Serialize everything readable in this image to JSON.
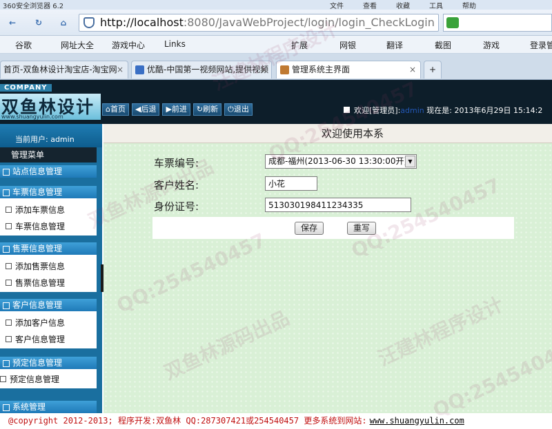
{
  "browser": {
    "app_name": "360安全浏览器 6.2",
    "menus": [
      "文件",
      "查看",
      "收藏",
      "工具",
      "帮助"
    ],
    "url_host": "http://localhost",
    "url_rest": ":8080/JavaWebProject/login/login_CheckLogin",
    "bookmarks": [
      "谷歌",
      "网址大全",
      "游戏中心",
      "Links",
      "扩展",
      "网银",
      "翻译",
      "截图",
      "游戏",
      "登录管"
    ],
    "tabs": [
      {
        "label": "首页-双鱼林设计淘宝店-淘宝网",
        "active": false
      },
      {
        "label": "优酷-中国第一视频网站,提供视频",
        "active": false
      },
      {
        "label": "管理系统主界面",
        "active": true
      }
    ]
  },
  "header": {
    "company": "COMPANY",
    "logo_text": "双鱼林设计",
    "logo_url": "www.shuangyulin.com",
    "toolbar": [
      "首页",
      "后退",
      "前进",
      "刷新",
      "退出"
    ],
    "welcome_prefix": "欢迎[管理员]:",
    "welcome_user": "admin",
    "time_label": "现在是: 2013年6月29日 15:14:2"
  },
  "sidebar": {
    "current_user": "当前用户: admin",
    "menu_title": "管理菜单",
    "groups": [
      {
        "title": "站点信息管理",
        "items": []
      },
      {
        "title": "车票信息管理",
        "items": [
          "添加车票信息",
          "车票信息管理"
        ]
      },
      {
        "title": "售票信息管理",
        "items": [
          "添加售票信息",
          "售票信息管理"
        ]
      },
      {
        "title": "客户信息管理",
        "items": [
          "添加客户信息",
          "客户信息管理"
        ]
      },
      {
        "title": "预定信息管理",
        "items": [
          "预定信息管理"
        ]
      },
      {
        "title": "系统管理",
        "items": []
      }
    ]
  },
  "content": {
    "title": "欢迎使用本系",
    "form": {
      "ticket_label": "车票编号:",
      "ticket_value": "成都-福州(2013-06-30 13:30:00开)",
      "name_label": "客户姓名:",
      "name_value": "小花",
      "id_label": "身份证号:",
      "id_value": "513030198411234335"
    },
    "save_label": "保存",
    "reset_label": "重写"
  },
  "footer": {
    "text": "@copyright 2012-2013; 程序开发:双鱼林  QQ:287307421或254540457  更多系统到网站:",
    "link": "www.shuangyulin.com"
  },
  "watermarks": [
    "双鱼林源码出品",
    "QQ:254540457",
    "汪建林程序设计",
    "QQ:254540457",
    "双鱼林源码出品",
    "QQ:254540457",
    "汪建林程序设计",
    "QQ:2545404"
  ]
}
